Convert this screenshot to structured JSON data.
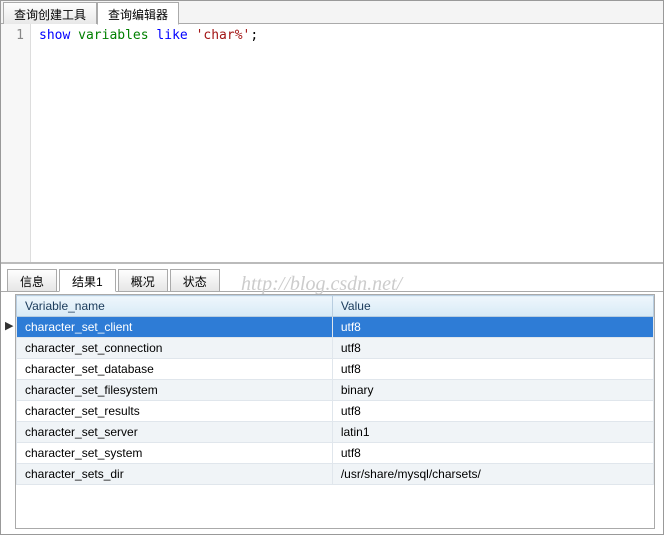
{
  "topTabs": {
    "create": "查询创建工具",
    "editor": "查询编辑器"
  },
  "editor": {
    "lineNumber": "1",
    "kw_show": "show",
    "kw_variables": "variables",
    "kw_like": "like",
    "str_pattern": "'char%'",
    "semicolon": ";"
  },
  "bottomTabs": {
    "info": "信息",
    "result1": "结果1",
    "overview": "概况",
    "status": "状态"
  },
  "watermark": "http://blog.csdn.net/",
  "resultHeaders": {
    "col1": "Variable_name",
    "col2": "Value"
  },
  "resultRows": [
    {
      "name": "character_set_client",
      "value": "utf8",
      "selected": true
    },
    {
      "name": "character_set_connection",
      "value": "utf8",
      "selected": false
    },
    {
      "name": "character_set_database",
      "value": "utf8",
      "selected": false
    },
    {
      "name": "character_set_filesystem",
      "value": "binary",
      "selected": false
    },
    {
      "name": "character_set_results",
      "value": "utf8",
      "selected": false
    },
    {
      "name": "character_set_server",
      "value": "latin1",
      "selected": false
    },
    {
      "name": "character_set_system",
      "value": "utf8",
      "selected": false
    },
    {
      "name": "character_sets_dir",
      "value": "/usr/share/mysql/charsets/",
      "selected": false
    }
  ]
}
